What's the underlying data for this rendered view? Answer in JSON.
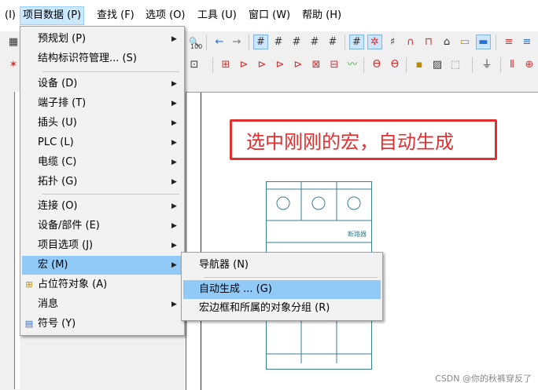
{
  "menubar": {
    "items": [
      {
        "label": "(I)"
      },
      {
        "label": "项目数据 (P)"
      },
      {
        "label": "查找 (F)"
      },
      {
        "label": "选项 (O)"
      },
      {
        "label": "工具 (U)"
      },
      {
        "label": "窗口 (W)"
      },
      {
        "label": "帮助 (H)"
      }
    ]
  },
  "dropdown": {
    "items": [
      {
        "label": "预规划 (P)",
        "submenu": true
      },
      {
        "label": "结构标识符管理... (S)",
        "submenu": false
      },
      {
        "label": "设备 (D)",
        "submenu": true
      },
      {
        "label": "端子排 (T)",
        "submenu": true
      },
      {
        "label": "插头 (U)",
        "submenu": true
      },
      {
        "label": "PLC (L)",
        "submenu": true
      },
      {
        "label": "电缆 (C)",
        "submenu": true
      },
      {
        "label": "拓扑 (G)",
        "submenu": true
      },
      {
        "label": "连接 (O)",
        "submenu": true
      },
      {
        "label": "设备/部件 (E)",
        "submenu": true
      },
      {
        "label": "项目选项 (J)",
        "submenu": true
      },
      {
        "label": "宏 (M)",
        "submenu": true
      },
      {
        "label": "占位符对象 (A)",
        "submenu": false
      },
      {
        "label": "消息",
        "submenu": true
      },
      {
        "label": "符号 (Y)",
        "submenu": false
      }
    ]
  },
  "submenu": {
    "items": [
      {
        "label": "导航器 (N)"
      },
      {
        "label": "自动生成 ... (G)"
      },
      {
        "label": "宏边框和所属的对象分组 (R)"
      }
    ]
  },
  "canvas": {
    "annotation": "选中刚刚的宏，自动生成",
    "breaker_label": "断路器"
  },
  "toolbar": {
    "zoom_text": "100"
  },
  "watermark": "CSDN @你的秋裤穿反了"
}
